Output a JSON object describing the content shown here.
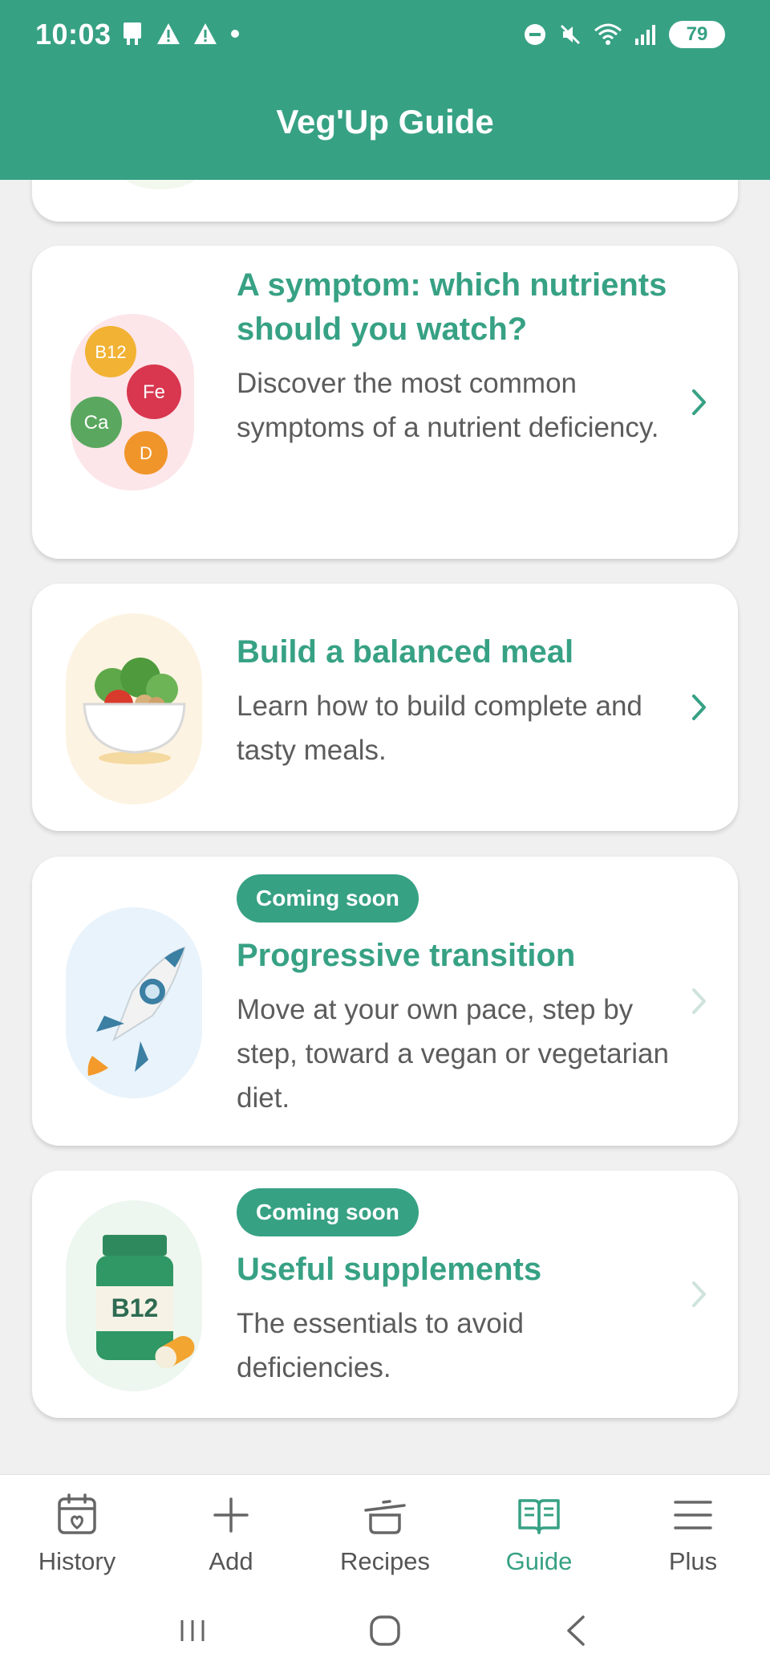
{
  "status": {
    "time": "10:03",
    "battery": "79"
  },
  "header": {
    "title": "Veg'Up Guide"
  },
  "cards": [
    {
      "title": "A symptom: which nutrients should you watch?",
      "description": "Discover the most common symptoms of a nutrient deficiency.",
      "nutrients": [
        "B12",
        "Fe",
        "Ca",
        "D"
      ]
    },
    {
      "title": "Build a balanced meal",
      "description": "Learn how to build complete and tasty meals."
    },
    {
      "badge": "Coming soon",
      "title": "Progressive transition",
      "description": "Move at your own pace, step by step, toward a vegan or vegetarian diet."
    },
    {
      "badge": "Coming soon",
      "title": "Useful supplements",
      "description": "The essentials to avoid deficiencies.",
      "bottle_label": "B12"
    }
  ],
  "nav": {
    "items": [
      {
        "label": "History",
        "icon": "calendar-heart-icon"
      },
      {
        "label": "Add",
        "icon": "plus-icon"
      },
      {
        "label": "Recipes",
        "icon": "cooking-pot-icon"
      },
      {
        "label": "Guide",
        "icon": "open-book-icon",
        "active": true
      },
      {
        "label": "Plus",
        "icon": "menu-icon"
      }
    ]
  },
  "colors": {
    "primary": "#37a184",
    "text": "#5c5c5c"
  }
}
